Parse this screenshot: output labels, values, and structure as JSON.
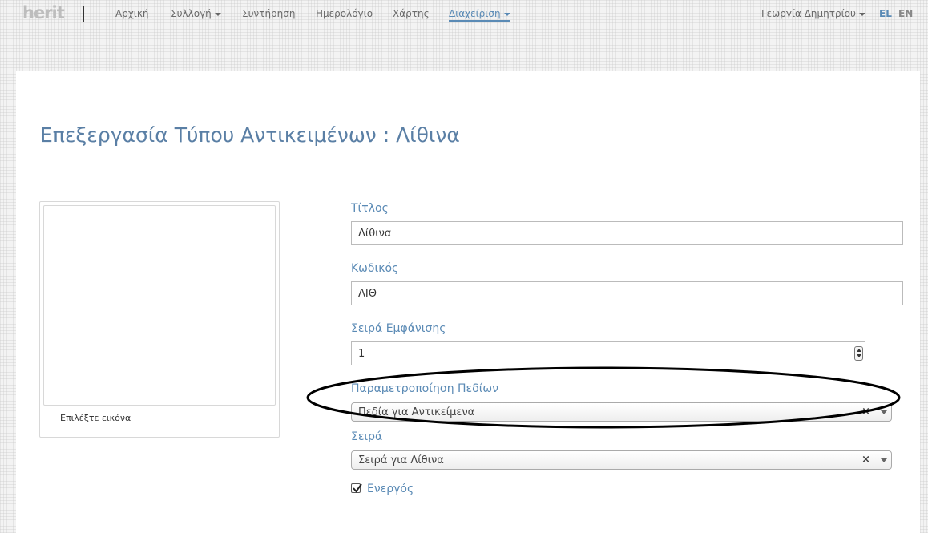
{
  "navbar": {
    "logo": "herit",
    "items": [
      {
        "label": "Αρχική"
      },
      {
        "label": "Συλλογή"
      },
      {
        "label": "Συντήρηση"
      },
      {
        "label": "Ημερολόγιο"
      },
      {
        "label": "Χάρτης"
      },
      {
        "label": "Διαχείριση"
      }
    ],
    "user": "Γεωργία Δημητρίου",
    "languages": [
      {
        "code": "EL",
        "color": "#5a8ab5"
      },
      {
        "code": "EN",
        "color": "#888888"
      }
    ]
  },
  "page": {
    "title": "Επεξεργασία Τύπου Αντικειμένων : Λίθινα"
  },
  "image_panel": {
    "caption": "Επιλέξτε εικόνα"
  },
  "form": {
    "title": {
      "label": "Τίτλος",
      "value": "Λίθινα"
    },
    "code": {
      "label": "Κωδικός",
      "value": "ΛΙΘ"
    },
    "display_order": {
      "label": "Σειρά Εμφάνισης",
      "value": "1"
    },
    "field_config": {
      "label": "Παραμετροποίηση Πεδίων",
      "value": "Πεδία για Αντικείμενα",
      "clear": "×"
    },
    "series": {
      "label": "Σειρά",
      "value": "Σειρά για Λίθινα",
      "clear": "×"
    },
    "active": {
      "label": "Ενεργός",
      "checked": true
    }
  },
  "colors": {
    "accent": "#5a8ab5",
    "title": "#5a7fa5"
  }
}
